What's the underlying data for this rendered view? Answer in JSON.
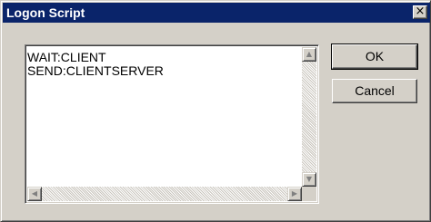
{
  "window": {
    "title": "Logon Script",
    "close_label": "×"
  },
  "script_editor": {
    "text": "WAIT:CLIENT\nSEND:CLIENTSERVER"
  },
  "scrollbars": {
    "up_arrow": "▲",
    "down_arrow": "▼",
    "left_arrow": "◀",
    "right_arrow": "▶"
  },
  "buttons": {
    "ok_label": "OK",
    "cancel_label": "Cancel"
  }
}
